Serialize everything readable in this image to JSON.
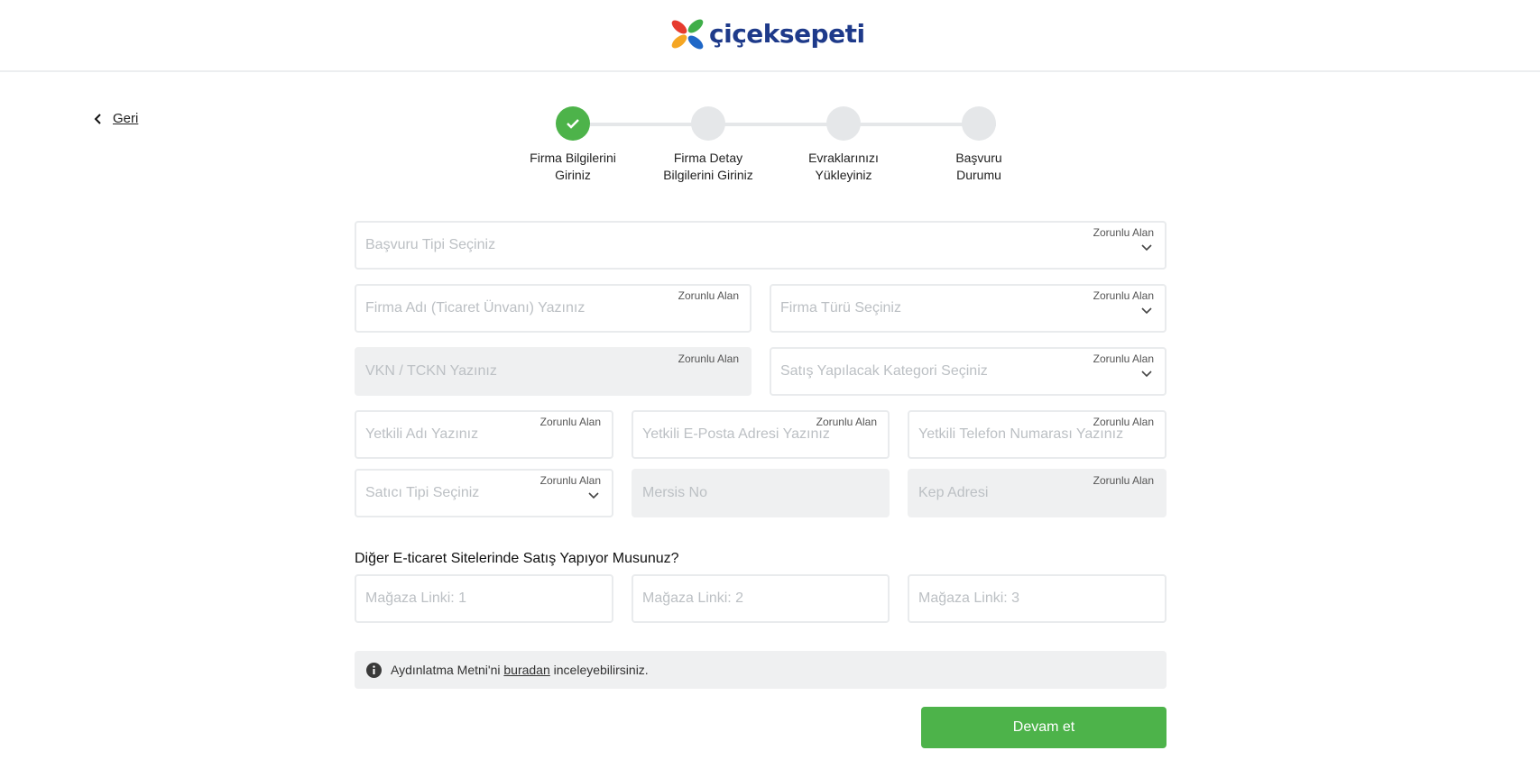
{
  "header": {
    "logo_text": "çiçeksepeti"
  },
  "back": {
    "label": "Geri"
  },
  "stepper": {
    "steps": [
      {
        "label": "Firma Bilgilerini\nGiriniz",
        "state": "done"
      },
      {
        "label": "Firma Detay\nBilgilerini Giriniz",
        "state": "pending"
      },
      {
        "label": "Evraklarınızı\nYükleyiniz",
        "state": "pending"
      },
      {
        "label": "Başvuru\nDurumu",
        "state": "pending"
      }
    ]
  },
  "form": {
    "required_label": "Zorunlu Alan",
    "application_type": {
      "placeholder": "Başvuru Tipi Seçiniz",
      "value": ""
    },
    "company_name": {
      "placeholder": "Firma Adı (Ticaret Ünvanı) Yazınız",
      "value": ""
    },
    "company_type": {
      "placeholder": "Firma Türü Seçiniz",
      "value": ""
    },
    "tax_id": {
      "placeholder": "VKN / TCKN Yazınız",
      "value": ""
    },
    "sales_category": {
      "placeholder": "Satış Yapılacak Kategori Seçiniz",
      "value": ""
    },
    "authorized_name": {
      "placeholder": "Yetkili Adı Yazınız",
      "value": ""
    },
    "authorized_email": {
      "placeholder": "Yetkili E-Posta Adresi Yazınız",
      "value": ""
    },
    "authorized_phone": {
      "placeholder": "Yetkili Telefon Numarası Yazınız",
      "value": ""
    },
    "seller_type": {
      "placeholder": "Satıcı Tipi Seçiniz",
      "value": ""
    },
    "mersis_no": {
      "placeholder": "Mersis No",
      "value": ""
    },
    "kep_address": {
      "placeholder": "Kep Adresi",
      "value": ""
    }
  },
  "other_sites": {
    "question": "Diğer E-ticaret Sitelerinde Satış Yapıyor Musunuz?",
    "links": [
      {
        "placeholder": "Mağaza Linki: 1"
      },
      {
        "placeholder": "Mağaza Linki: 2"
      },
      {
        "placeholder": "Mağaza Linki: 3"
      }
    ]
  },
  "info": {
    "prefix": "Aydınlatma Metni'ni",
    "link": "buradan",
    "suffix": "inceleyebilirsiniz."
  },
  "actions": {
    "continue_label": "Devam et"
  },
  "colors": {
    "brand_green": "#4db34a",
    "logo_blue": "#1e3a8a",
    "step_inactive": "#e5e7e9",
    "field_disabled": "#eff0f1"
  }
}
